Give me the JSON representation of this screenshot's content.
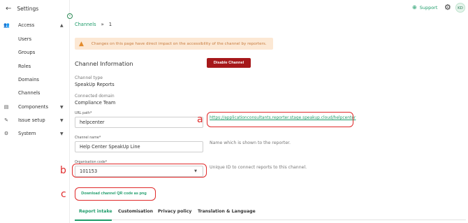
{
  "sidebar": {
    "header": "Settings",
    "groups": [
      {
        "label": "Access",
        "icon": "people-icon",
        "expanded": true
      },
      {
        "label": "Components",
        "icon": "database-icon",
        "expanded": false
      },
      {
        "label": "Issue setup",
        "icon": "tools-icon",
        "expanded": false
      },
      {
        "label": "System",
        "icon": "gear-icon",
        "expanded": false
      }
    ],
    "access_items": [
      "Users",
      "Groups",
      "Roles",
      "Domains",
      "Channels"
    ]
  },
  "topbar": {
    "support_label": "Support",
    "avatar_initials": "KD"
  },
  "breadcrumb": {
    "parent": "Channels",
    "separator": "»",
    "current": "1"
  },
  "warning": {
    "text": "Changes on this page have direct impact on the accessibility of the channel by reporters."
  },
  "channel": {
    "section_title": "Channel Information",
    "disable_button": "Disable Channel",
    "type_label": "Channel type",
    "type_value": "SpeakUp Reports",
    "domain_label": "Connected domain",
    "domain_value": "Compliance Team",
    "url_label": "URL path*",
    "url_value": "helpcenter",
    "url_link": "https://applicationconsultants.reporter.stage.speakup.cloud/helpcenter",
    "name_label": "Channel name*",
    "name_value": "Help Center SpeakUp Line",
    "name_helper": "Name which is shown to the reporter.",
    "org_label": "Organisation code*",
    "org_value": "101153",
    "org_helper": "Unique ID to connect reports to this channel.",
    "qr_button": "Download channel QR code as png"
  },
  "tabs": [
    "Report intake",
    "Customisation",
    "Privacy policy",
    "Translation & Language"
  ],
  "active_tab": "Report intake",
  "annotations": [
    "a",
    "b",
    "c"
  ],
  "colors": {
    "accent": "#1e9c6a",
    "danger": "#a6181a",
    "warning_bg": "#fce8d4",
    "annotation": "#e02a2a"
  }
}
